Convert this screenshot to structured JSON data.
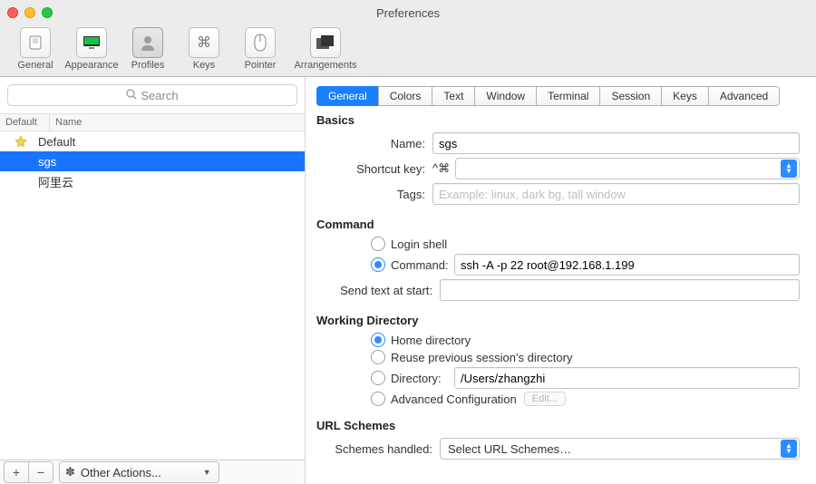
{
  "window": {
    "title": "Preferences"
  },
  "toolbar": [
    {
      "id": "general",
      "label": "General"
    },
    {
      "id": "appearance",
      "label": "Appearance"
    },
    {
      "id": "profiles",
      "label": "Profiles",
      "selected": true
    },
    {
      "id": "keys",
      "label": "Keys"
    },
    {
      "id": "pointer",
      "label": "Pointer"
    },
    {
      "id": "arrangements",
      "label": "Arrangements"
    }
  ],
  "sidebar": {
    "search_placeholder": "Search",
    "headers": {
      "col1": "Default",
      "col2": "Name"
    },
    "profiles": [
      {
        "name": "Default",
        "default": true,
        "selected": false
      },
      {
        "name": "sgs",
        "default": false,
        "selected": true
      },
      {
        "name": "阿里云",
        "default": false,
        "selected": false
      }
    ],
    "add": "+",
    "remove": "−",
    "other": "Other Actions..."
  },
  "tabs": [
    "General",
    "Colors",
    "Text",
    "Window",
    "Terminal",
    "Session",
    "Keys",
    "Advanced"
  ],
  "active_tab": "General",
  "sections": {
    "basics": {
      "header": "Basics",
      "name_label": "Name:",
      "name_value": "sgs",
      "shortcut_label": "Shortcut key:",
      "shortcut_prefix": "^⌘",
      "shortcut_value": "",
      "tags_label": "Tags:",
      "tags_placeholder": "Example: linux, dark bg, tall window",
      "tags_value": ""
    },
    "command": {
      "header": "Command",
      "login_shell": "Login shell",
      "command_label": "Command:",
      "command_value": "ssh -A -p 22 root@192.168.1.199",
      "command_selected": true,
      "send_label": "Send text at start:",
      "send_value": ""
    },
    "working": {
      "header": "Working Directory",
      "home": "Home directory",
      "reuse": "Reuse previous session's directory",
      "dir_label": "Directory:",
      "dir_value": "/Users/zhangzhi",
      "adv": "Advanced Configuration",
      "edit": "Edit...",
      "selected": "home"
    },
    "url": {
      "header": "URL Schemes",
      "label": "Schemes handled:",
      "value": "Select URL Schemes…"
    }
  }
}
